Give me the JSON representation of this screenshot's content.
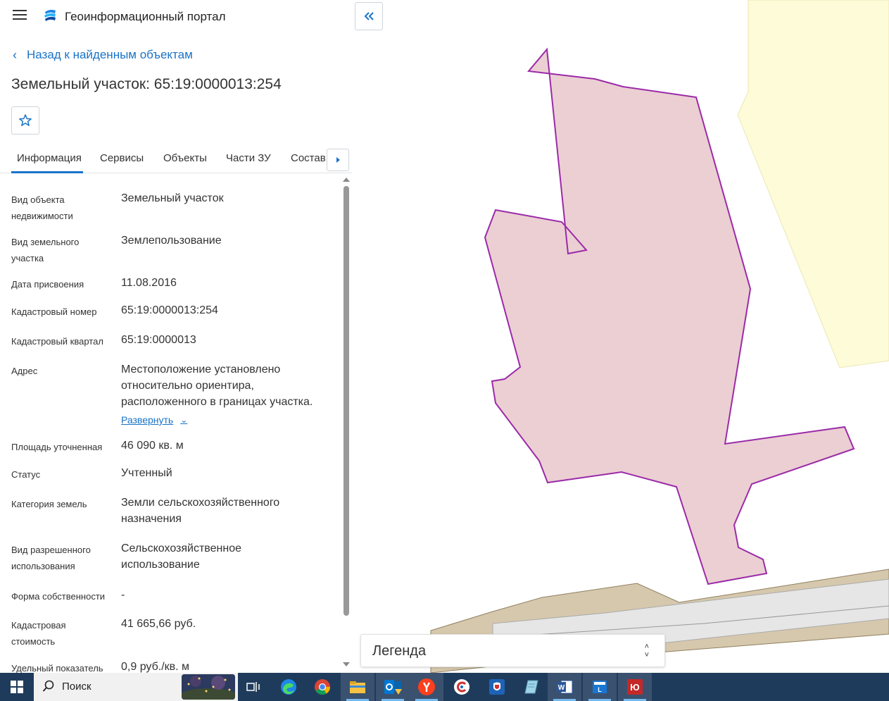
{
  "header": {
    "portal_title": "Геоинформационный портал",
    "menu_icon": "hamburger-menu-icon",
    "logo_icon": "portal-logo-icon"
  },
  "nav": {
    "back_label": "Назад к найденным объектам"
  },
  "object": {
    "title": "Земельный участок: 65:19:0000013:254"
  },
  "tabs": [
    {
      "label": "Информация",
      "active": true
    },
    {
      "label": "Сервисы",
      "active": false
    },
    {
      "label": "Объекты",
      "active": false
    },
    {
      "label": "Части ЗУ",
      "active": false
    },
    {
      "label": "Состав",
      "active": false
    }
  ],
  "info": {
    "rows": [
      {
        "label": "Вид объекта недвижимости",
        "value": "Земельный участок"
      },
      {
        "label": "Вид земельного участка",
        "value": "Землепользование"
      },
      {
        "label": "Дата присвоения",
        "value": "11.08.2016"
      },
      {
        "label": "Кадастровый номер",
        "value": "65:19:0000013:254"
      },
      {
        "label": "Кадастровый квартал",
        "value": "65:19:0000013"
      },
      {
        "label": "Адрес",
        "value": "Местоположение установлено относительно ориентира, расположенного в границах участка.",
        "expand": "Развернуть"
      },
      {
        "label": "Площадь уточненная",
        "value": "46 090 кв. м"
      },
      {
        "label": "Статус",
        "value": "Учтенный"
      },
      {
        "label": "Категория земель",
        "value": "Земли сельскохозяйственного назначения"
      },
      {
        "label": "Вид разрешенного использования",
        "value": "Сельскохозяйственное использование"
      },
      {
        "label": "Форма собственности",
        "value": "-"
      },
      {
        "label": "Кадастровая стоимость",
        "value": "41 665,66 руб."
      },
      {
        "label": "Удельный показатель",
        "value": "0,9 руб./кв. м"
      }
    ]
  },
  "map": {
    "legend_label": "Легенда",
    "parcel_fill": "#ebcfd3",
    "parcel_stroke": "#9b2aa8",
    "zone_fill": "#fdfbd8",
    "road_fill": "#d6c8ad",
    "road_stripe": "#e6e6e6"
  },
  "taskbar": {
    "search_placeholder": "Поиск",
    "apps": [
      "task-view-icon",
      "edge-icon",
      "chrome-icon",
      "file-explorer-icon",
      "outlook-icon",
      "yandex-browser-icon",
      "ccleaner-icon",
      "gosuslugi-icon",
      "notepad-icon",
      "word-icon",
      "remote-icon",
      "app-yu-icon"
    ]
  }
}
